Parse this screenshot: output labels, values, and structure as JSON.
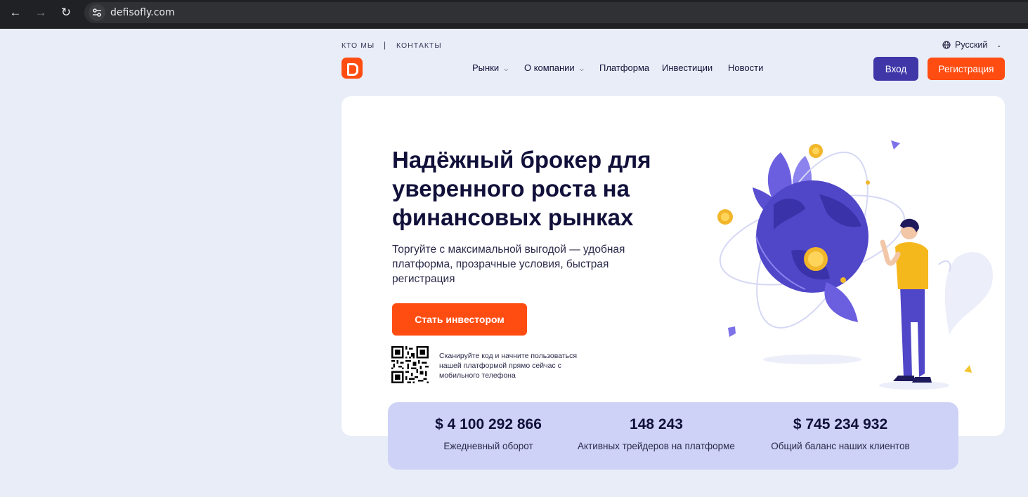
{
  "browser": {
    "url": "defisofly.com"
  },
  "header": {
    "top_links": [
      "КТО МЫ",
      "КОНТАКТЫ"
    ],
    "separator": "|",
    "language": "Русский",
    "nav": [
      {
        "label": "Рынки",
        "has_dropdown": true
      },
      {
        "label": "О компании",
        "has_dropdown": true
      },
      {
        "label": "Платформа",
        "has_dropdown": false
      },
      {
        "label": "Инвестиции",
        "has_dropdown": false
      },
      {
        "label": "Новости",
        "has_dropdown": false
      }
    ],
    "login_label": "Вход",
    "register_label": "Регистрация"
  },
  "hero": {
    "title": "Надёжный брокер для уверенного роста на финансовых рынках",
    "subtitle": "Торгуйте с максимальной выгодой — удобная платформа, прозрачные условия, быстрая регистрация",
    "cta_label": "Стать инвестором",
    "qr_text": "Сканируйте код и начните пользоваться нашей платформой прямо сейчас с мобильного телефона"
  },
  "stats": [
    {
      "value": "$ 4 100 292 866",
      "label": "Ежедневный оборот"
    },
    {
      "value": "148 243",
      "label": "Активных трейдеров на платформе"
    },
    {
      "value": "$ 745 234 932",
      "label": "Общий баланс наших клиентов"
    }
  ],
  "colors": {
    "accent_orange": "#ff4d12",
    "accent_indigo": "#3f36a8",
    "page_bg": "#e9edf8",
    "stats_bg": "#cdd2f6"
  },
  "icons": [
    "back-arrow-icon",
    "forward-arrow-icon",
    "reload-icon",
    "site-settings-icon",
    "globe-icon",
    "chevron-down-icon",
    "logo-icon",
    "qr-code-icon"
  ]
}
